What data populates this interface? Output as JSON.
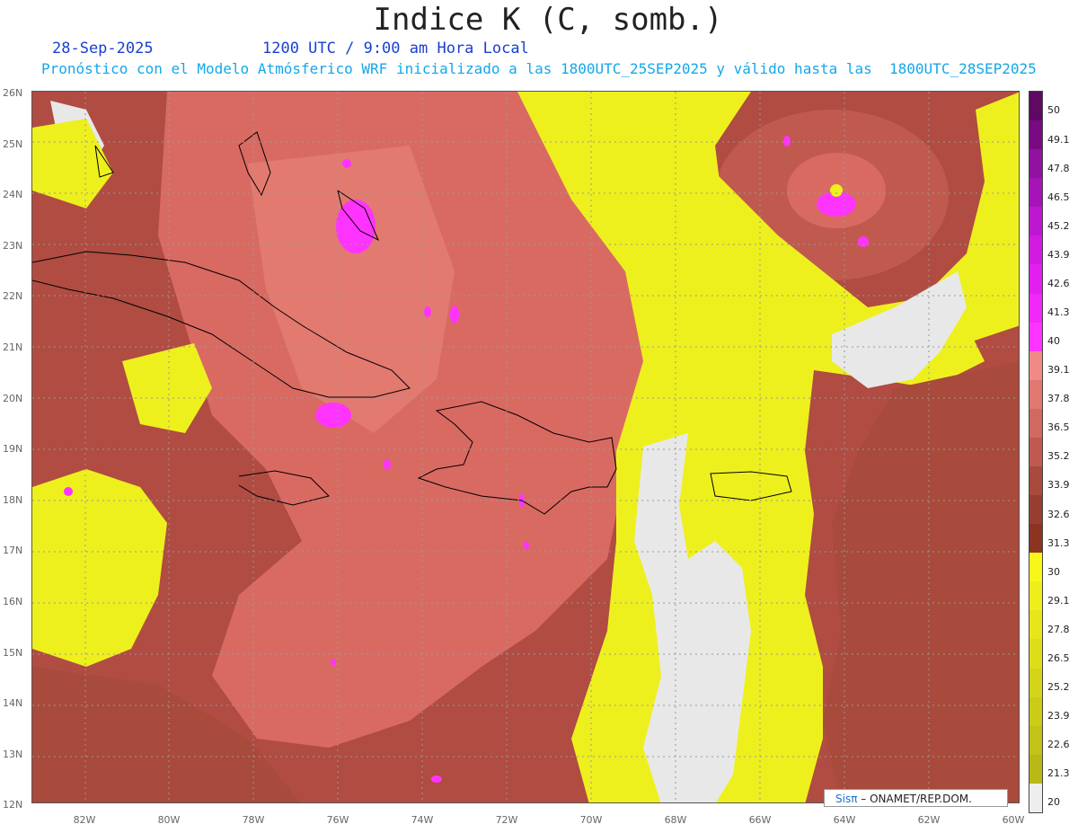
{
  "header": {
    "title": "Indice K (C, somb.)",
    "date": "28-Sep-2025",
    "time": "1200 UTC / 9:00 am Hora Local",
    "subtitle": "Pronóstico con el Modelo Atmósferico WRF inicializado a las 1800UTC_25SEP2025 y válido hasta las  1800UTC_28SEP2025"
  },
  "axes": {
    "lat_labels": [
      "26N",
      "25N",
      "24N",
      "23N",
      "22N",
      "21N",
      "20N",
      "19N",
      "18N",
      "17N",
      "16N",
      "15N",
      "14N",
      "13N",
      "12N"
    ],
    "lon_labels": [
      "82W",
      "80W",
      "78W",
      "76W",
      "74W",
      "72W",
      "70W",
      "68W",
      "66W",
      "64W",
      "62W",
      "60W"
    ]
  },
  "colorbar": {
    "labels": [
      "50",
      "49.1",
      "47.8",
      "46.5",
      "45.2",
      "43.9",
      "42.6",
      "41.3",
      "40",
      "39.1",
      "37.8",
      "36.5",
      "35.2",
      "33.9",
      "32.6",
      "31.3",
      "30",
      "29.1",
      "27.8",
      "26.5",
      "25.2",
      "23.9",
      "22.6",
      "21.3",
      "20"
    ],
    "colors": [
      "#5e0a63",
      "#7a0a82",
      "#9012a0",
      "#a614b8",
      "#bd18d0",
      "#d21be0",
      "#e11fee",
      "#f028f8",
      "#ff33ff",
      "#f08a86",
      "#e07870",
      "#d06a5e",
      "#c05a4e",
      "#a84a3c",
      "#983e30",
      "#8c3420",
      "#f7f71a",
      "#eeef1a",
      "#e6e61a",
      "#dddd1a",
      "#d4d41a",
      "#cbcb18",
      "#c2c218",
      "#b8b816",
      "#eeeeee"
    ]
  },
  "credit": {
    "logo": "Sisπ",
    "text": "– ONAMET/REP.DOM."
  }
}
